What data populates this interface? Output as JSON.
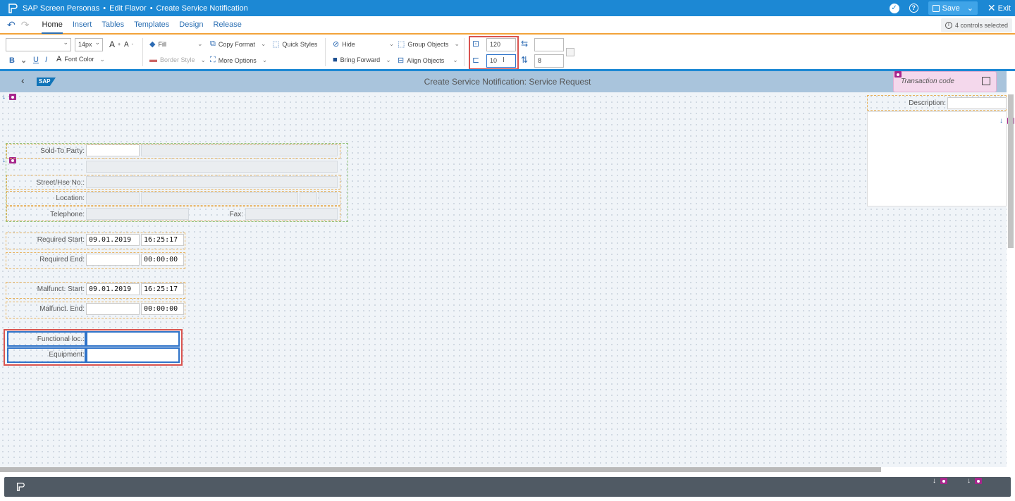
{
  "titlebar": {
    "app": "SAP Screen Personas",
    "mode": "Edit Flavor",
    "transaction": "Create Service Notification",
    "save": "Save",
    "exit": "Exit"
  },
  "tabs": [
    "Home",
    "Insert",
    "Tables",
    "Templates",
    "Design",
    "Release"
  ],
  "active_tab": "Home",
  "selection_info": "4 controls selected",
  "ribbon": {
    "font_family": "",
    "font_size": "14px",
    "font_color": "Font Color",
    "fill": "Fill",
    "border_style": "Border Style",
    "copy_format": "Copy Format",
    "more_options": "More Options",
    "quick_styles": "Quick Styles",
    "hide": "Hide",
    "bring_forward": "Bring Forward",
    "group_objects": "Group Objects",
    "align_objects": "Align Objects",
    "top": "120",
    "left": "10",
    "width": "",
    "height": "8"
  },
  "screen": {
    "title": "Create Service Notification: Service Request",
    "transaction_code_placeholder": "Transaction code",
    "description_label": "Description:",
    "sold_to_party": "Sold-To Party:",
    "street": "Street/Hse No.:",
    "location": "Location:",
    "telephone": "Telephone:",
    "fax": "Fax:",
    "required_start": "Required Start:",
    "required_start_date": "09.01.2019",
    "required_start_time": "16:25:17",
    "required_end": "Required End:",
    "required_end_time": "00:00:00",
    "malfunct_start": "Malfunct. Start:",
    "malfunct_start_date": "09.01.2019",
    "malfunct_start_time": "16:25:17",
    "malfunct_end": "Malfunct. End:",
    "malfunct_end_time": "00:00:00",
    "functional_loc": "Functional loc.:",
    "equipment": "Equipment:"
  },
  "colors": {
    "titlebar": "#1c88d4",
    "accent": "#f2a33a",
    "header_strip": "#a9c4dc",
    "tcode_bg": "#f4d8ec",
    "eye_badge": "#a7268c",
    "selection": "#2f73c9",
    "highlight": "#d9534f",
    "footer": "#505a64"
  }
}
